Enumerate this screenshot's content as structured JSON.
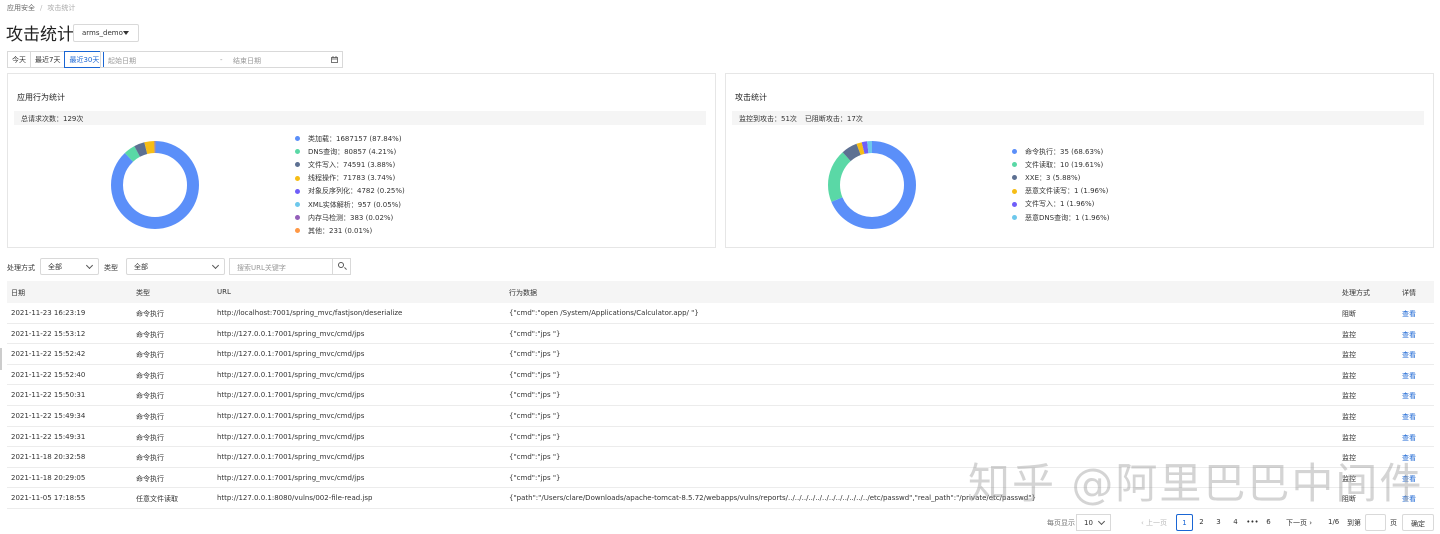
{
  "breadcrumb": {
    "parent": "应用安全",
    "separator": "/",
    "current": "攻击统计"
  },
  "page_title": "攻击统计",
  "app_selector": {
    "value": "arms_demo"
  },
  "range_buttons": [
    "今天",
    "最近7天",
    "最近30天"
  ],
  "range_active": 2,
  "date_range": {
    "start_placeholder": "起始日期",
    "end_placeholder": "结束日期",
    "separator": "-"
  },
  "panel_behavior": {
    "title": "应用行为统计",
    "summary_label": "总请求次数：",
    "summary_value": "129次",
    "legend": [
      {
        "label": "类加载：",
        "value": "1687157 (87.84%)",
        "color": "#5b8ff9",
        "pct": 87.84
      },
      {
        "label": "DNS查询：",
        "value": "80857 (4.21%)",
        "color": "#5ad8a6",
        "pct": 4.21
      },
      {
        "label": "文件写入：",
        "value": "74591 (3.88%)",
        "color": "#5d7092",
        "pct": 3.88
      },
      {
        "label": "线程操作：",
        "value": "71783 (3.74%)",
        "color": "#f6bd16",
        "pct": 3.74
      },
      {
        "label": "对象反序列化：",
        "value": "4782 (0.25%)",
        "color": "#6f5ef9",
        "pct": 0.25
      },
      {
        "label": "XML实体解析：",
        "value": "957 (0.05%)",
        "color": "#6dc8ec",
        "pct": 0.05
      },
      {
        "label": "内存马检测：",
        "value": "383 (0.02%)",
        "color": "#945fb9",
        "pct": 0.02
      },
      {
        "label": "其他：",
        "value": "231 (0.01%)",
        "color": "#ff9845",
        "pct": 0.01
      }
    ]
  },
  "panel_attack": {
    "title": "攻击统计",
    "summary_label1": "监控到攻击：",
    "summary_value1": "51次",
    "summary_label2": "已阻断攻击：",
    "summary_value2": "17次",
    "legend": [
      {
        "label": "命令执行：",
        "value": "35 (68.63%)",
        "color": "#5b8ff9",
        "pct": 68.63
      },
      {
        "label": "文件读取：",
        "value": "10 (19.61%)",
        "color": "#5ad8a6",
        "pct": 19.61
      },
      {
        "label": "XXE：",
        "value": "3 (5.88%)",
        "color": "#5d7092",
        "pct": 5.88
      },
      {
        "label": "恶意文件读写：",
        "value": "1 (1.96%)",
        "color": "#f6bd16",
        "pct": 1.96
      },
      {
        "label": "文件写入：",
        "value": "1 (1.96%)",
        "color": "#6f5ef9",
        "pct": 1.96
      },
      {
        "label": "恶意DNS查询：",
        "value": "1 (1.96%)",
        "color": "#6dc8ec",
        "pct": 1.96
      }
    ]
  },
  "filters": {
    "method_label": "处理方式",
    "method_value": "全部",
    "type_label": "类型",
    "type_value": "全部",
    "search_placeholder": "搜索URL关键字"
  },
  "table": {
    "headers": {
      "date": "日期",
      "type": "类型",
      "url": "URL",
      "data": "行为数据",
      "method": "处理方式",
      "detail": "详情"
    },
    "rows": [
      {
        "date": "2021-11-23 16:23:19",
        "type": "命令执行",
        "url": "http://localhost:7001/spring_mvc/fastjson/deserialize",
        "data": "{\"cmd\":\"open /System/Applications/Calculator.app/ \"}",
        "method": "阻断",
        "detail": "查看"
      },
      {
        "date": "2021-11-22 15:53:12",
        "type": "命令执行",
        "url": "http://127.0.0.1:7001/spring_mvc/cmd/jps",
        "data": "{\"cmd\":\"jps \"}",
        "method": "监控",
        "detail": "查看"
      },
      {
        "date": "2021-11-22 15:52:42",
        "type": "命令执行",
        "url": "http://127.0.0.1:7001/spring_mvc/cmd/jps",
        "data": "{\"cmd\":\"jps \"}",
        "method": "监控",
        "detail": "查看"
      },
      {
        "date": "2021-11-22 15:52:40",
        "type": "命令执行",
        "url": "http://127.0.0.1:7001/spring_mvc/cmd/jps",
        "data": "{\"cmd\":\"jps \"}",
        "method": "监控",
        "detail": "查看"
      },
      {
        "date": "2021-11-22 15:50:31",
        "type": "命令执行",
        "url": "http://127.0.0.1:7001/spring_mvc/cmd/jps",
        "data": "{\"cmd\":\"jps \"}",
        "method": "监控",
        "detail": "查看"
      },
      {
        "date": "2021-11-22 15:49:34",
        "type": "命令执行",
        "url": "http://127.0.0.1:7001/spring_mvc/cmd/jps",
        "data": "{\"cmd\":\"jps \"}",
        "method": "监控",
        "detail": "查看"
      },
      {
        "date": "2021-11-22 15:49:31",
        "type": "命令执行",
        "url": "http://127.0.0.1:7001/spring_mvc/cmd/jps",
        "data": "{\"cmd\":\"jps \"}",
        "method": "监控",
        "detail": "查看"
      },
      {
        "date": "2021-11-18 20:32:58",
        "type": "命令执行",
        "url": "http://127.0.0.1:7001/spring_mvc/cmd/jps",
        "data": "{\"cmd\":\"jps \"}",
        "method": "监控",
        "detail": "查看"
      },
      {
        "date": "2021-11-18 20:29:05",
        "type": "命令执行",
        "url": "http://127.0.0.1:7001/spring_mvc/cmd/jps",
        "data": "{\"cmd\":\"jps \"}",
        "method": "监控",
        "detail": "查看"
      },
      {
        "date": "2021-11-05 17:18:55",
        "type": "任意文件读取",
        "url": "http://127.0.0.1:8080/vulns/002-file-read.jsp",
        "data": "{\"path\":\"/Users/clare/Downloads/apache-tomcat-8.5.72/webapps/vulns/reports/../../../../../../../../../../../../etc/passwd\",\"real_path\":\"/private/etc/passwd\"}",
        "method": "阻断",
        "detail": "查看"
      }
    ]
  },
  "pagination": {
    "page_size_label": "每页显示",
    "page_size_value": "10",
    "prev": "上一页",
    "pages": [
      "1",
      "2",
      "3",
      "4",
      "•••",
      "6"
    ],
    "current_page": "1",
    "next": "下一页",
    "page_info": "1/6",
    "goto_label": "到第",
    "goto_suffix": "页",
    "confirm": "确定"
  },
  "watermark": "知乎 @阿里巴巴中间件"
}
